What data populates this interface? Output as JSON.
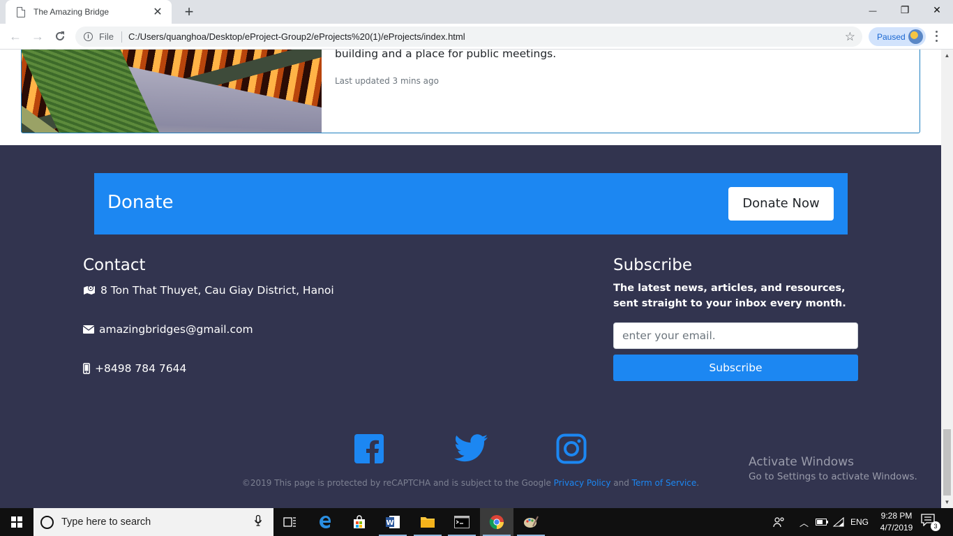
{
  "browser": {
    "tab_title": "The Amazing Bridge",
    "tab_close": "✕",
    "new_tab": "+",
    "omnibox_scheme": "File",
    "omnibox_url": "C:/Users/quanghoa/Desktop/eProject-Group2/eProjects%20(1)/eProjects/index.html",
    "profile_status": "Paused",
    "window_controls": {
      "minimize": "—",
      "restore": "❐",
      "close": "✕"
    }
  },
  "card": {
    "text": "building and a place for public meetings.",
    "updated": "Last updated 3 mins ago"
  },
  "donate": {
    "title": "Donate",
    "button": "Donate Now"
  },
  "contact": {
    "heading": "Contact",
    "address": "8 Ton That Thuyet, Cau Giay District, Hanoi",
    "email": "amazingbridges@gmail.com",
    "phone": "+8498 784 7644"
  },
  "subscribe": {
    "heading": "Subscribe",
    "text": "The latest news, articles, and resources, sent straight to your inbox every month.",
    "placeholder": "enter your email.",
    "button": "Subscribe"
  },
  "social": [
    "facebook-icon",
    "twitter-icon",
    "instagram-icon"
  ],
  "footer": {
    "copyright_prefix": "©2019 This page is protected by reCAPTCHA and is subject to the Google ",
    "privacy_link": "Privacy Policy",
    "and": " and ",
    "terms_link": "Term of Service",
    "suffix": "."
  },
  "watermark": {
    "line1": "Activate Windows",
    "line2": "Go to Settings to activate Windows."
  },
  "taskbar": {
    "search_placeholder": "Type here to search",
    "language": "ENG",
    "time": "9:28 PM",
    "date": "4/7/2019",
    "notification_count": "3"
  },
  "colors": {
    "accent": "#1c87f2",
    "footer_bg": "#32344f",
    "card_border": "#1f7fbf"
  }
}
